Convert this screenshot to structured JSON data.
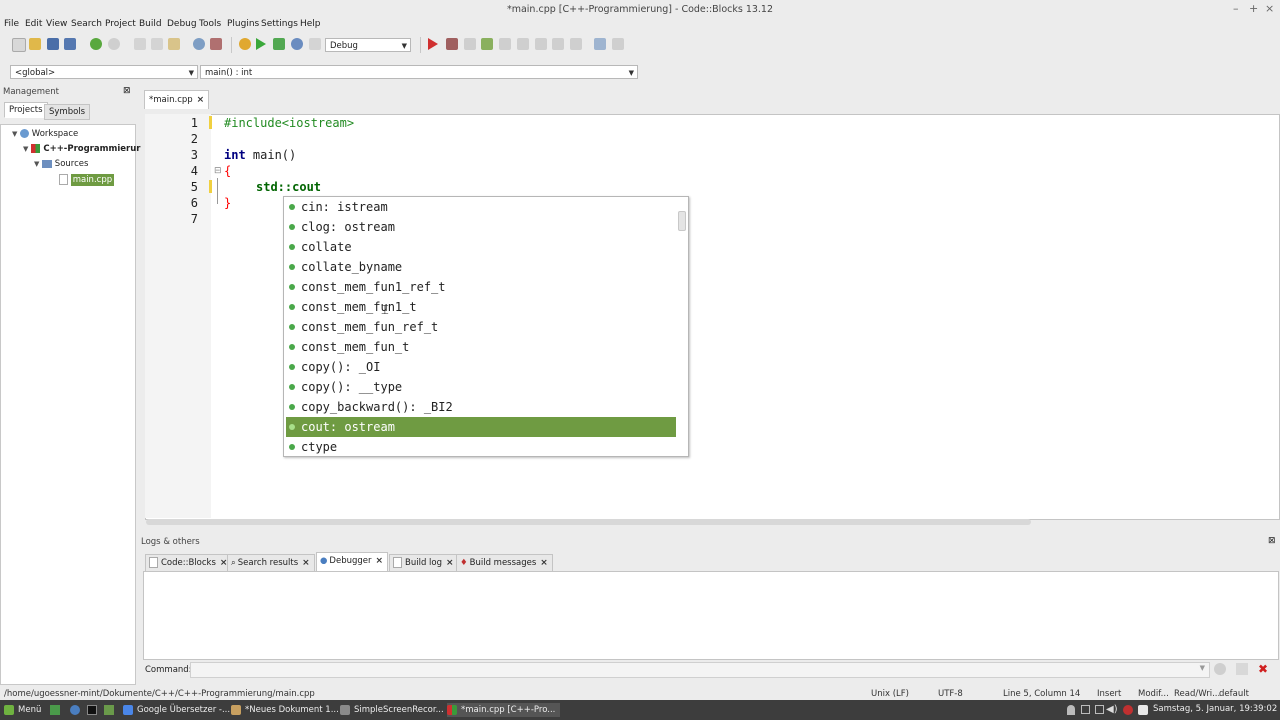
{
  "window": {
    "title": "*main.cpp [C++-Programmierung] - Code::Blocks 13.12",
    "minimize_glyph": "–",
    "maximize_glyph": "+",
    "close_glyph": "×"
  },
  "menu": [
    "File",
    "Edit",
    "View",
    "Search",
    "Project",
    "Build",
    "Debug",
    "Tools",
    "Plugins",
    "Settings",
    "Help"
  ],
  "toolbar": {
    "build_target": "Debug"
  },
  "codebar": {
    "scope": "<global>",
    "function": "main() : int"
  },
  "management": {
    "title": "Management",
    "tabs": [
      "Projects",
      "Symbols"
    ],
    "tree": {
      "workspace": "Workspace",
      "project": "C++-Programmierur",
      "folder": "Sources",
      "file": "main.cpp"
    }
  },
  "editor": {
    "tab": "*main.cpp",
    "line_numbers": [
      "1",
      "2",
      "3",
      "4",
      "5",
      "6",
      "7"
    ],
    "code": {
      "l1": "#include<iostream>",
      "l3_kw": "int",
      "l3_rest": " main()",
      "l4": "{",
      "l5": "std::cout",
      "l6": "}"
    }
  },
  "autocomplete": {
    "items": [
      "cin: istream",
      "clog: ostream",
      "collate",
      "collate_byname",
      "const_mem_fun1_ref_t",
      "const_mem_fun1_t",
      "const_mem_fun_ref_t",
      "const_mem_fun_t",
      "copy(): _OI",
      "copy(): __type",
      "copy_backward(): _BI2",
      "cout: ostream",
      "ctype"
    ],
    "selected_index": 11
  },
  "logs": {
    "title": "Logs & others",
    "tabs": [
      "Code::Blocks",
      "Search results",
      "Debugger",
      "Build log",
      "Build messages"
    ],
    "active_tab": "Debugger",
    "command_label": "Command:"
  },
  "statusbar": {
    "path": "/home/ugoessner-mint/Dokumente/C++/C++-Programmierung/main.cpp",
    "eol": "Unix (LF)",
    "encoding": "UTF-8",
    "position": "Line 5, Column 14",
    "mode": "Insert",
    "modified": "Modif...",
    "access": "Read/Wri...",
    "profile": "default"
  },
  "taskbar": {
    "menu": "Menü",
    "tasks": [
      "Google Übersetzer -...",
      "*Neues Dokument 1...",
      "SimpleScreenRecor...",
      "*main.cpp [C++-Pro..."
    ],
    "clock": "Samstag, 5. Januar, 19:39:02"
  },
  "colors": {
    "selection": "#6f9b42",
    "keyword": "#000080",
    "preprocessor": "#228b22",
    "brace": "#ff0000"
  }
}
